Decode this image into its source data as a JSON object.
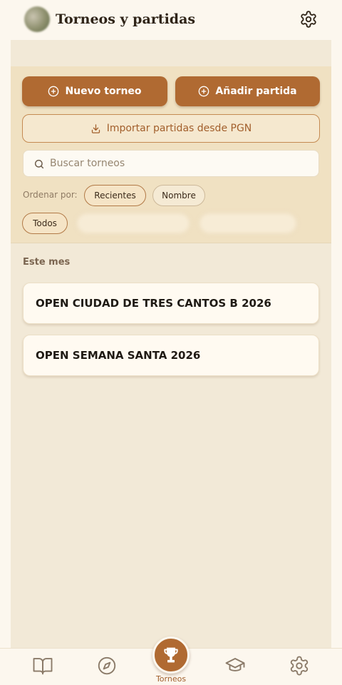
{
  "header": {
    "title": "Torneos y partidas",
    "avatar_icon": "user-avatar",
    "settings_icon": "gear-icon"
  },
  "actions": {
    "new_tournament_label": "Nuevo torneo",
    "add_game_label": "Añadir partida",
    "import_pgn_label": "Importar partidas desde PGN"
  },
  "search": {
    "placeholder": "Buscar torneos",
    "value": ""
  },
  "sort": {
    "label": "Ordenar por:",
    "options": [
      "Recientes",
      "Nombre"
    ],
    "selected": "Recientes"
  },
  "filters": {
    "items": [
      "Todos"
    ],
    "selected": "Todos"
  },
  "sections": [
    {
      "label": "Este mes",
      "tournaments": [
        "OPEN CIUDAD DE TRES CANTOS B 2026",
        "OPEN SEMANA SANTA 2026"
      ]
    }
  ],
  "bottom_nav": {
    "items": [
      {
        "icon": "book-icon",
        "label": ""
      },
      {
        "icon": "compass-icon",
        "label": ""
      },
      {
        "icon": "trophy-icon",
        "label": "Torneos"
      },
      {
        "icon": "graduation-cap-icon",
        "label": ""
      },
      {
        "icon": "gear-icon",
        "label": ""
      }
    ],
    "active": "Torneos"
  },
  "colors": {
    "accent": "#b06a32",
    "background": "#fcf7ee",
    "panel": "#f0e1c2",
    "content": "#f2e9d7"
  }
}
